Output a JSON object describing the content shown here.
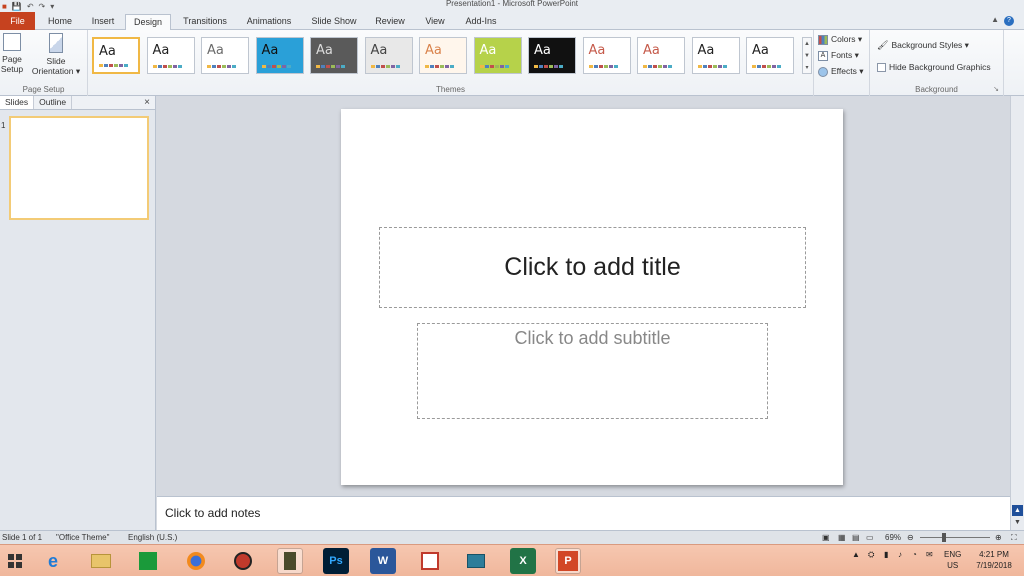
{
  "window": {
    "title": "Presentation1 - Microsoft PowerPoint"
  },
  "tabs": [
    {
      "label": "File"
    },
    {
      "label": "Home"
    },
    {
      "label": "Insert"
    },
    {
      "label": "Design"
    },
    {
      "label": "Transitions"
    },
    {
      "label": "Animations"
    },
    {
      "label": "Slide Show"
    },
    {
      "label": "Review"
    },
    {
      "label": "View"
    },
    {
      "label": "Add-Ins"
    }
  ],
  "ribbon": {
    "page_setup": {
      "page_setup_label": "Page\nSetup",
      "orientation_label": "Slide\nOrientation ▾",
      "group_label": "Page Setup"
    },
    "themes": {
      "group_label": "Themes",
      "aa": "Aa"
    },
    "variants": {
      "colors": "Colors ▾",
      "fonts": "Fonts ▾",
      "effects": "Effects ▾"
    },
    "background": {
      "styles": "Background Styles ▾",
      "hide_graphics": "Hide Background Graphics",
      "group_label": "Background"
    }
  },
  "pane": {
    "slides_tab": "Slides",
    "outline_tab": "Outline",
    "close": "×",
    "slide_number": "1"
  },
  "slide": {
    "title_placeholder": "Click to add title",
    "subtitle_placeholder": "Click to add subtitle"
  },
  "notes": {
    "placeholder": "Click to add notes"
  },
  "status": {
    "slide": "Slide 1 of 1",
    "theme": "\"Office Theme\"",
    "language": "English (U.S.)",
    "zoom": "69%",
    "zoom_level": 0.69
  },
  "taskbar": {
    "lang": "ENG",
    "region": "US",
    "time": "4:21 PM",
    "date": "7/19/2018"
  },
  "icons": {
    "theme_colors": [
      "#f0b845",
      "#4f81bd",
      "#c0504d",
      "#9bbb59",
      "#8064a2",
      "#4bacc6"
    ]
  },
  "themes_list": [
    {
      "name": "office",
      "bg": "#ffffff",
      "fg": "#222222"
    },
    {
      "name": "adjacency",
      "bg": "#ffffff",
      "fg": "#222222"
    },
    {
      "name": "angles",
      "bg": "#ffffff",
      "fg": "#6b6b6b"
    },
    {
      "name": "apex",
      "bg": "#2aa0d8",
      "fg": "#111111"
    },
    {
      "name": "apothecary",
      "bg": "#5a5a5a",
      "fg": "#dcdcdc"
    },
    {
      "name": "aspect",
      "bg": "#e8e8e8",
      "fg": "#444444"
    },
    {
      "name": "austin",
      "bg": "#fff6ec",
      "fg": "#d9824b"
    },
    {
      "name": "black-tie",
      "bg": "#b6d24a",
      "fg": "#ffffff"
    },
    {
      "name": "civic",
      "bg": "#111111",
      "fg": "#ffffff"
    },
    {
      "name": "clarity",
      "bg": "#ffffff",
      "fg": "#c55a4a"
    },
    {
      "name": "composite",
      "bg": "#ffffff",
      "fg": "#c55a4a"
    },
    {
      "name": "concourse",
      "bg": "#ffffff",
      "fg": "#222222"
    },
    {
      "name": "elemental",
      "bg": "#ffffff",
      "fg": "#222222"
    }
  ]
}
